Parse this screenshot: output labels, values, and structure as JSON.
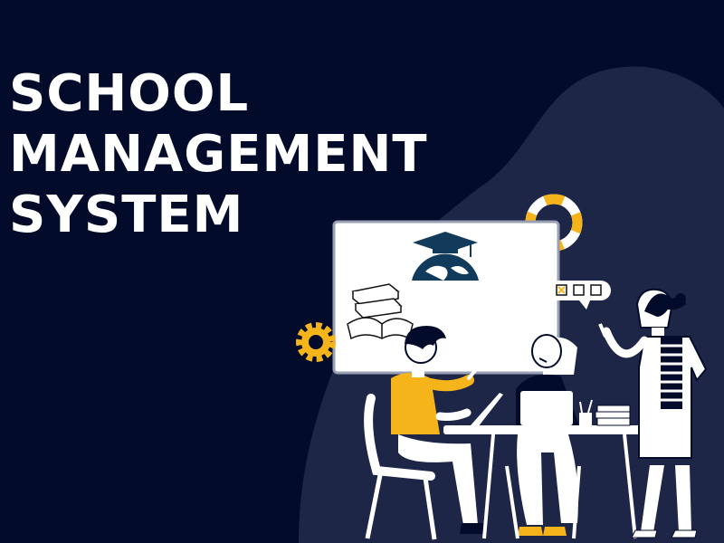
{
  "hero": {
    "title_lines": [
      "SCHOOL",
      "MANAGEMENT",
      "SYSTEM"
    ]
  },
  "colors": {
    "background": "#030b2b",
    "blob": "#1e2648",
    "accent_yellow": "#f5b41a",
    "whiteboard": "#ffffff",
    "ink": "#0a1233"
  },
  "icons": [
    "graduation-globe-icon",
    "books-icon",
    "gear-icon",
    "lifebuoy-icon",
    "checkbox-bubble-icon"
  ]
}
